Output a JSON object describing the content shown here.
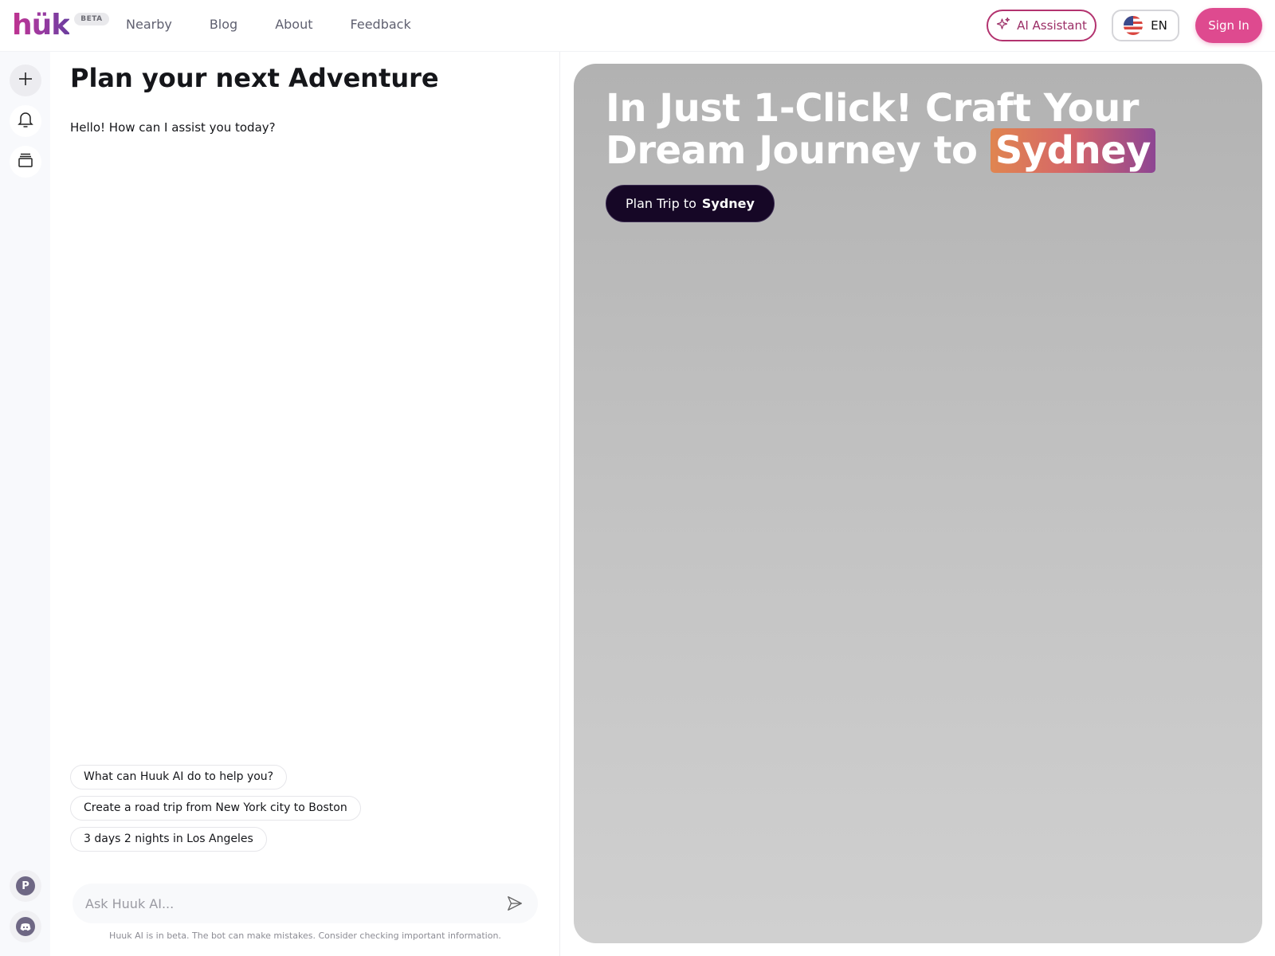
{
  "header": {
    "logo_text": "hük",
    "beta_badge": "BETA",
    "nav": [
      "Nearby",
      "Blog",
      "About",
      "Feedback"
    ],
    "ai_assistant_label": "AI Assistant",
    "language_label": "EN",
    "sign_in_label": "Sign In"
  },
  "sidebar": {
    "items": [
      {
        "icon": "plus-icon",
        "label": "New chat"
      },
      {
        "icon": "bell-icon",
        "label": "Notifications"
      },
      {
        "icon": "stack-icon",
        "label": "Trips"
      }
    ],
    "bottom": [
      {
        "icon": "product-hunt-icon",
        "glyph": "P"
      },
      {
        "icon": "discord-icon",
        "glyph": ""
      }
    ]
  },
  "chat": {
    "title": "Plan your next Adventure",
    "greeting": "Hello! How can I assist you today?",
    "suggestions": [
      "What can Huuk AI do to help you?",
      "Create a road trip from New York city to Boston",
      "3 days 2 nights in Los Angeles"
    ],
    "input_placeholder": "Ask Huuk AI...",
    "input_value": "",
    "disclaimer": "Huuk AI is in beta. The bot can make mistakes. Consider checking important information."
  },
  "hero": {
    "headline_prefix": "In Just 1-Click! Craft Your Dream Journey to",
    "destination": "Sydney",
    "plan_button_prefix": "Plan Trip to",
    "plan_button_destination": "Sydney"
  },
  "colors": {
    "brand_pink": "#de4a8f",
    "brand_purple": "#6a3d9e",
    "plan_button_bg": "#160726"
  }
}
